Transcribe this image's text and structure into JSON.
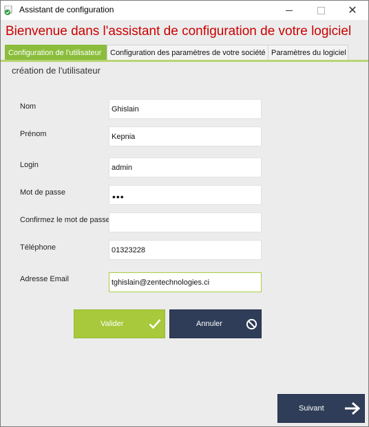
{
  "window": {
    "title": "Assistant  de configuration",
    "controls": {
      "minimize": "minimize",
      "maximize": "maximize",
      "close": "close"
    }
  },
  "header": {
    "welcome": "Bienvenue dans l'assistant de configuration de votre logiciel"
  },
  "tabs": [
    {
      "label": "Configuration de l'utilisateur",
      "active": true
    },
    {
      "label": "Configuration des paramètres de votre société",
      "active": false
    },
    {
      "label": "Paramètres du logiciel",
      "active": false
    }
  ],
  "section": {
    "title": "création de l'utilisateur"
  },
  "form": {
    "nom": {
      "label": "Nom",
      "value": "Ghislain"
    },
    "prenom": {
      "label": "Prénom",
      "value": "Kepnia"
    },
    "login": {
      "label": "Login",
      "value": "admin"
    },
    "password": {
      "label": "Mot de passe",
      "value": "•••"
    },
    "confirm": {
      "label": "Confirmez le mot de passe",
      "value": ""
    },
    "telephone": {
      "label": "Téléphone",
      "value": "01323228"
    },
    "email": {
      "label": "Adresse Email",
      "value": "tghislain@zentechnologies.ci"
    }
  },
  "buttons": {
    "valider": "Valider",
    "annuler": "Annuler",
    "suivant": "Suivant"
  },
  "colors": {
    "accent_green": "#8bbd3c",
    "button_green": "#a7c93b",
    "button_navy": "#2f3d58",
    "title_red": "#cc0000"
  }
}
